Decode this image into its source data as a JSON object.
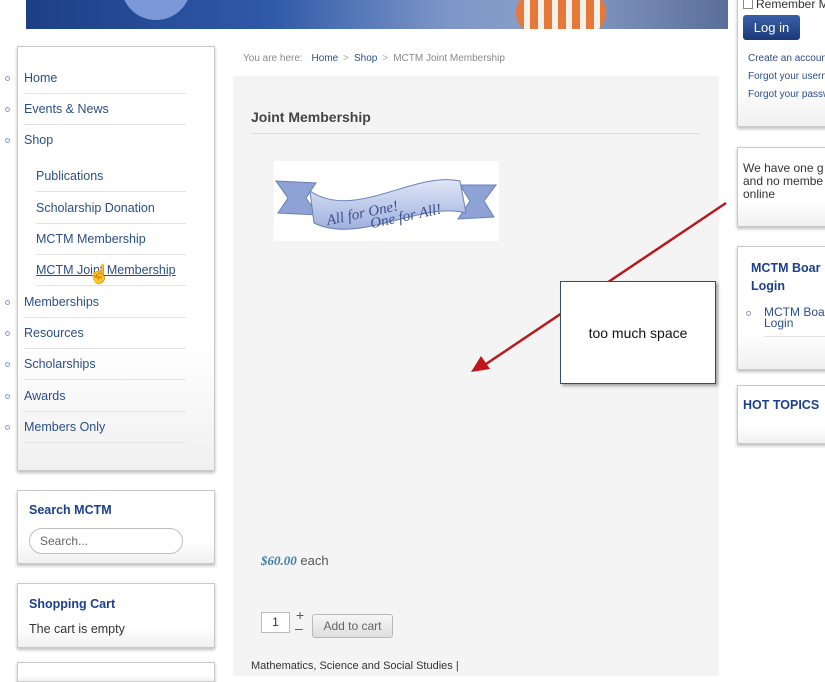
{
  "breadcrumb": {
    "prefix": "You are here:",
    "items": [
      "Home",
      "Shop",
      "MCTM Joint Membership"
    ],
    "sep": ">"
  },
  "menu": {
    "items": [
      {
        "label": "Home"
      },
      {
        "label": "Events & News"
      },
      {
        "label": "Shop"
      },
      {
        "label": "Publications"
      },
      {
        "label": "Scholarship Donation"
      },
      {
        "label": "MCTM Membership"
      },
      {
        "label": "MCTM Joint Membership"
      },
      {
        "label": "Memberships"
      },
      {
        "label": "Resources"
      },
      {
        "label": "Scholarships"
      },
      {
        "label": "Awards"
      },
      {
        "label": "Members Only"
      }
    ]
  },
  "search": {
    "title": "Search MCTM",
    "placeholder": "Search..."
  },
  "cart": {
    "title": "Shopping Cart",
    "empty_text": "The cart is empty"
  },
  "main": {
    "title": "Joint Membership",
    "image_text_line1": "All for One!",
    "image_text_line2": "One for All!",
    "price": "$60.00",
    "price_suffix": "each",
    "quantity": "1",
    "plus": "+",
    "minus": "–",
    "add_to_cart": "Add to cart",
    "bottom_text": "Mathematics, Science and Social Studies |"
  },
  "annotation": {
    "text": "too much space"
  },
  "login": {
    "remember": "Remember M",
    "button": "Log in",
    "links": [
      "Create an account",
      "Forgot your userna",
      "Forgot your passw"
    ]
  },
  "members": {
    "line1": "We have one g",
    "line2": "and no membe",
    "line3": "online"
  },
  "board": {
    "title_line1": "MCTM Boar",
    "title_line2": "Login",
    "link_line1": "MCTM Boar",
    "link_line2": "Login"
  },
  "hot": {
    "title": "HOT TOPICS"
  },
  "colors": {
    "link": "#2b4e8a",
    "title_blue": "#1b3f8f",
    "arrow": "#c0161b"
  }
}
